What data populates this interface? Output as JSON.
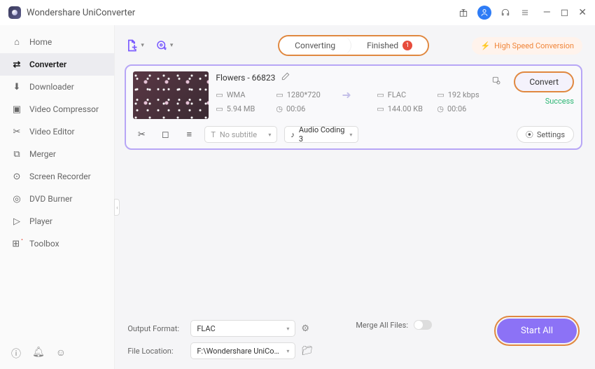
{
  "app": {
    "title": "Wondershare UniConverter"
  },
  "titlebar_icons": {
    "gift": "gift-icon",
    "user": "user-badge",
    "headset": "headset-icon",
    "menu": "menu-icon"
  },
  "sidebar": {
    "items": [
      {
        "label": "Home",
        "icon": "home-icon"
      },
      {
        "label": "Converter",
        "icon": "converter-icon",
        "active": true
      },
      {
        "label": "Downloader",
        "icon": "downloader-icon"
      },
      {
        "label": "Video Compressor",
        "icon": "compressor-icon"
      },
      {
        "label": "Video Editor",
        "icon": "editor-icon"
      },
      {
        "label": "Merger",
        "icon": "merger-icon"
      },
      {
        "label": "Screen Recorder",
        "icon": "recorder-icon"
      },
      {
        "label": "DVD Burner",
        "icon": "dvd-icon"
      },
      {
        "label": "Player",
        "icon": "player-icon"
      },
      {
        "label": "Toolbox",
        "icon": "toolbox-icon"
      }
    ]
  },
  "tabs": {
    "converting": "Converting",
    "finished": "Finished",
    "finished_count": "1"
  },
  "hsc": {
    "label": "High Speed Conversion"
  },
  "file": {
    "name": "Flowers - 66823",
    "src": {
      "format": "WMA",
      "res": "1280*720",
      "size": "5.94 MB",
      "dur": "00:06"
    },
    "dst": {
      "format": "FLAC",
      "bitrate": "192 kbps",
      "size": "144.00 KB",
      "dur": "00:06"
    },
    "convert_btn": "Convert",
    "status": "Success",
    "subtitle_placeholder": "No subtitle",
    "audio_codec": "Audio Coding 3",
    "settings_btn": "Settings"
  },
  "bottom": {
    "output_format_label": "Output Format:",
    "output_format_value": "FLAC",
    "file_location_label": "File Location:",
    "file_location_value": "F:\\Wondershare UniConverter",
    "merge_label": "Merge All Files:",
    "start_all": "Start All"
  }
}
